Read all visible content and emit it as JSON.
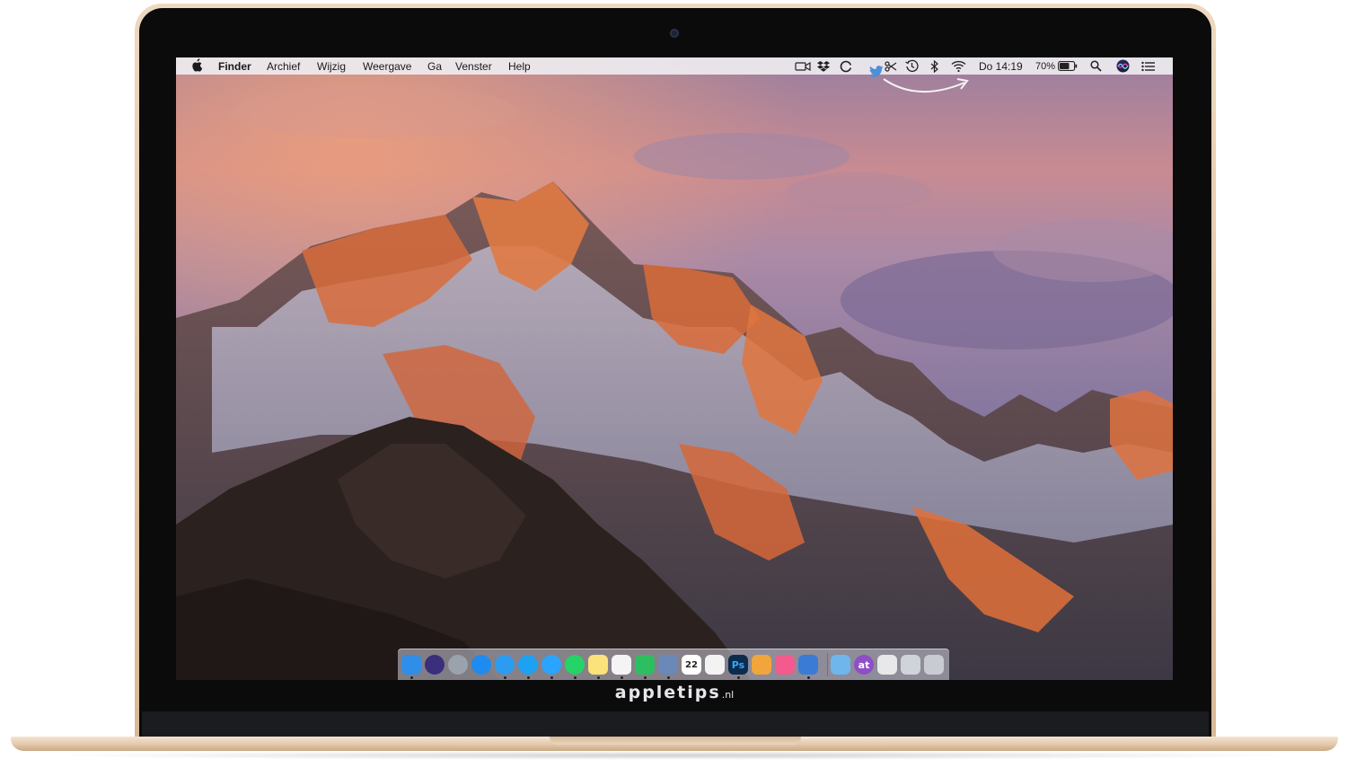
{
  "menubar": {
    "apple_icon": "apple-icon",
    "items": [
      "Finder",
      "Archief",
      "Wijzig",
      "Weergave",
      "Ga",
      "Venster",
      "Help"
    ],
    "clock": "Do 14:19",
    "battery_percent": "70%",
    "battery_level": 0.7,
    "status_icons": [
      "facetime-camera-icon",
      "dropbox-icon",
      "copyclip-icon",
      "twitter-icon",
      "scissors-icon",
      "time-machine-icon",
      "bluetooth-icon",
      "wifi-icon",
      "battery-icon",
      "spotlight-search-icon",
      "siri-icon",
      "notification-center-icon"
    ]
  },
  "dock": {
    "apps": [
      {
        "name": "finder-icon",
        "color": "#2f8ee8",
        "running": true
      },
      {
        "name": "siri-icon",
        "color": "#3a2f7a",
        "running": false
      },
      {
        "name": "launchpad-icon",
        "color": "#9aa3ad",
        "running": false
      },
      {
        "name": "app-store-icon",
        "color": "#1e8bf0",
        "running": false
      },
      {
        "name": "safari-icon",
        "color": "#2c9cf2",
        "running": true
      },
      {
        "name": "twitter-icon",
        "color": "#1da1f2",
        "running": true
      },
      {
        "name": "messages-icon",
        "color": "#2ba4ff",
        "running": true
      },
      {
        "name": "whatsapp-icon",
        "color": "#25d366",
        "running": true
      },
      {
        "name": "notes-icon",
        "color": "#fbe27a",
        "running": true
      },
      {
        "name": "reminders-icon",
        "color": "#f4f4f4",
        "running": true
      },
      {
        "name": "evernote-icon",
        "color": "#2dbe60",
        "running": true
      },
      {
        "name": "preview-icon",
        "color": "#6a89b8",
        "running": true
      },
      {
        "name": "calendar-icon",
        "color": "#ffffff",
        "running": false,
        "label": "22"
      },
      {
        "name": "photos-icon",
        "color": "#f3f3f3",
        "running": false
      },
      {
        "name": "photoshop-icon",
        "color": "#0c2c4e",
        "running": true,
        "label": "Ps"
      },
      {
        "name": "pages-icon",
        "color": "#f1a53a",
        "running": false
      },
      {
        "name": "itunes-icon",
        "color": "#f25b8c",
        "running": false
      },
      {
        "name": "tweetbot-icon",
        "color": "#3a7bd5",
        "running": true
      },
      {
        "name": "downloads-folder-icon",
        "color": "#6fb6ec",
        "running": false
      },
      {
        "name": "at-icon",
        "color": "#8e4fc6",
        "running": false,
        "label": "at"
      },
      {
        "name": "documents-stack-icon",
        "color": "#e8e8ea",
        "running": false
      },
      {
        "name": "screenshots-stack-icon",
        "color": "#cfd3da",
        "running": false
      },
      {
        "name": "trash-icon",
        "color": "#c8ccd2",
        "running": false
      }
    ]
  },
  "brand": {
    "name": "appletips",
    "tld": ".nl"
  }
}
